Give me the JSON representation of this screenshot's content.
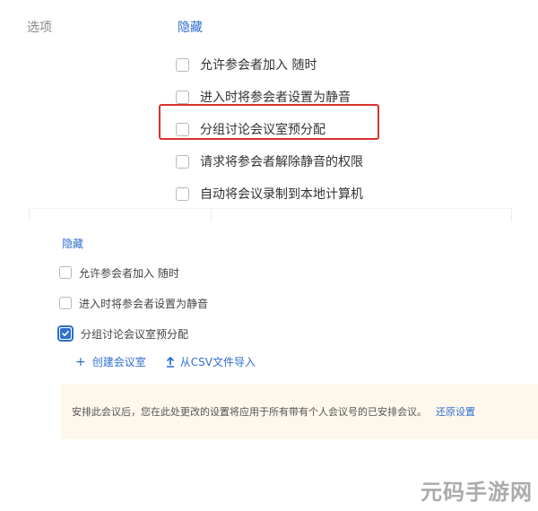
{
  "options_label": "选项",
  "top_panel": {
    "hide_link": "隐藏",
    "items": [
      {
        "label": "允许参会者加入 随时",
        "checked": false
      },
      {
        "label": "进入时将参会者设置为静音",
        "checked": false
      },
      {
        "label": "分组讨论会议室预分配",
        "checked": false,
        "highlighted": true
      },
      {
        "label": "请求将参会者解除静音的权限",
        "checked": false
      },
      {
        "label": "自动将会议录制到本地计算机",
        "checked": false
      }
    ]
  },
  "bottom_panel": {
    "hide_link": "隐藏",
    "items": [
      {
        "label": "允许参会者加入 随时",
        "checked": false
      },
      {
        "label": "进入时将参会者设置为静音",
        "checked": false
      },
      {
        "label": "分组讨论会议室预分配",
        "checked": true
      }
    ],
    "actions": {
      "create_room": "创建会议室",
      "import_csv": "从CSV文件导入"
    },
    "notice": {
      "text": "安排此会议后，您在此处更改的设置将应用于所有带有个人会议号的已安排会议。",
      "restore_link": "还原设置"
    }
  },
  "watermark": "元码手游网",
  "colors": {
    "accent": "#2f6fd0",
    "highlight_border": "#d9322e",
    "notice_bg": "#fdf7ec"
  }
}
